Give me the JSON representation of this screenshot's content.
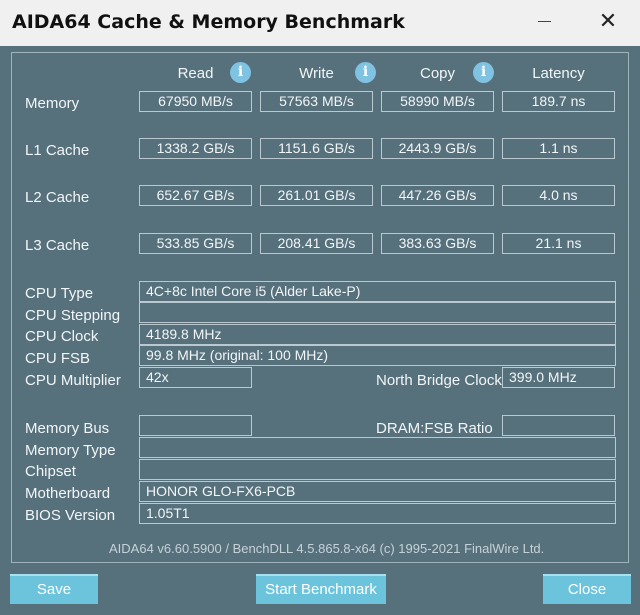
{
  "window": {
    "title": "AIDA64 Cache & Memory Benchmark"
  },
  "columns": {
    "read": "Read",
    "write": "Write",
    "copy": "Copy",
    "latency": "Latency"
  },
  "rows": [
    {
      "label": "Memory",
      "read": "67950 MB/s",
      "write": "57563 MB/s",
      "copy": "58990 MB/s",
      "latency": "189.7 ns"
    },
    {
      "label": "L1 Cache",
      "read": "1338.2 GB/s",
      "write": "1151.6 GB/s",
      "copy": "2443.9 GB/s",
      "latency": "1.1 ns"
    },
    {
      "label": "L2 Cache",
      "read": "652.67 GB/s",
      "write": "261.01 GB/s",
      "copy": "447.26 GB/s",
      "latency": "4.0 ns"
    },
    {
      "label": "L3 Cache",
      "read": "533.85 GB/s",
      "write": "208.41 GB/s",
      "copy": "383.63 GB/s",
      "latency": "21.1 ns"
    }
  ],
  "cpu": {
    "type_label": "CPU Type",
    "type": "4C+8c Intel Core i5  (Alder Lake-P)",
    "stepping_label": "CPU Stepping",
    "stepping": "",
    "clock_label": "CPU Clock",
    "clock": "4189.8 MHz",
    "fsb_label": "CPU FSB",
    "fsb": "99.8 MHz  (original: 100 MHz)",
    "multiplier_label": "CPU Multiplier",
    "multiplier": "42x",
    "nb_clock_label": "North Bridge Clock",
    "nb_clock": "399.0 MHz"
  },
  "memory": {
    "bus_label": "Memory Bus",
    "bus": "",
    "dram_ratio_label": "DRAM:FSB Ratio",
    "dram_ratio": "",
    "type_label": "Memory Type",
    "type": "",
    "chipset_label": "Chipset",
    "chipset": "",
    "motherboard_label": "Motherboard",
    "motherboard": "HONOR GLO-FX6-PCB",
    "bios_label": "BIOS Version",
    "bios": "1.05T1"
  },
  "footer": {
    "version": "AIDA64 v6.60.5900 / BenchDLL 4.5.865.8-x64  (c) 1995-2021 FinalWire Ltd."
  },
  "buttons": {
    "save": "Save",
    "start": "Start Benchmark",
    "close": "Close"
  },
  "icons": {
    "info": "i",
    "close": "✕"
  }
}
